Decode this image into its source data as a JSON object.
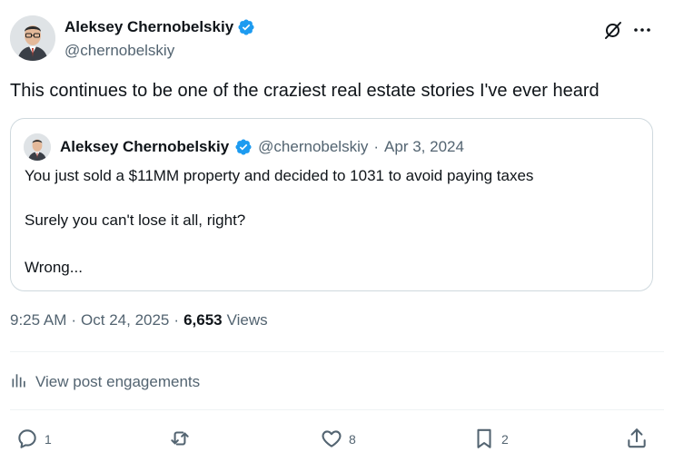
{
  "post": {
    "author_name": "Aleksey Chernobelskiy",
    "author_handle": "@chernobelskiy",
    "text": "This continues to be one of the craziest real estate stories I've ever heard",
    "icons": [
      "verified-badge-icon",
      "grok-icon",
      "more-icon"
    ]
  },
  "quote": {
    "author_name": "Aleksey Chernobelskiy",
    "author_handle": "@chernobelskiy",
    "separator": "·",
    "date": "Apr 3, 2024",
    "lines": [
      "You just sold a $11MM property and decided to 1031 to avoid paying taxes",
      "Surely you can't lose it all, right?",
      "Wrong..."
    ]
  },
  "meta": {
    "time": "9:25 AM",
    "separator": "·",
    "date": "Oct 24, 2025",
    "views_count": "6,653",
    "views_label": "Views"
  },
  "engagements": {
    "label": "View post engagements"
  },
  "actions": {
    "replies": "1",
    "reposts": "",
    "likes": "8",
    "bookmarks": "2"
  },
  "colors": {
    "text": "#0f1419",
    "secondary": "#536471",
    "border": "#cfd9de",
    "verified": "#1d9bf0"
  }
}
